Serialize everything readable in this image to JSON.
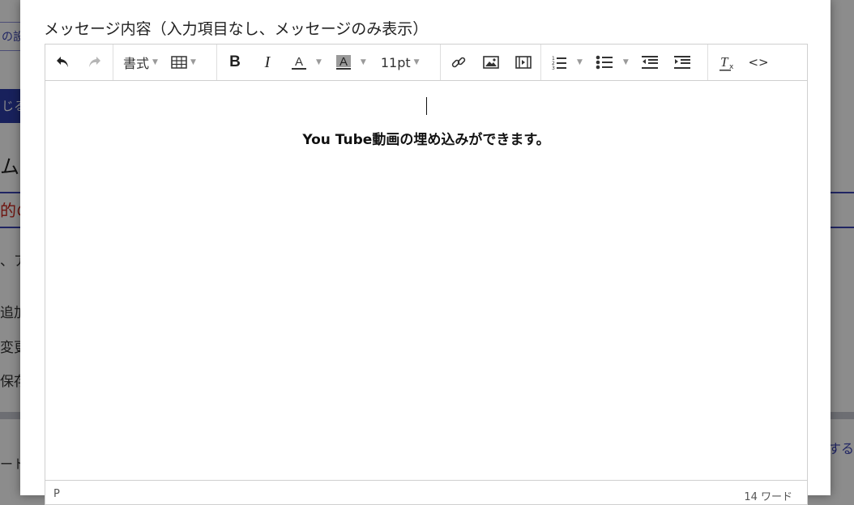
{
  "background": {
    "link_text": "の設",
    "button_text": "じる",
    "heading": "ムの",
    "red_text": "的の",
    "text1": "、ア",
    "text2": "追加",
    "text3": "変更",
    "text4": "保存",
    "text5": "ート",
    "right_link": "する"
  },
  "modal": {
    "field_label": "メッセージ内容（入力項目なし、メッセージのみ表示）"
  },
  "toolbar": {
    "format_label": "書式",
    "font_size": "11pt"
  },
  "editor": {
    "content_text": "You Tube動画の埋め込みができます。",
    "status_path": "P",
    "word_count": "14 ワード"
  }
}
